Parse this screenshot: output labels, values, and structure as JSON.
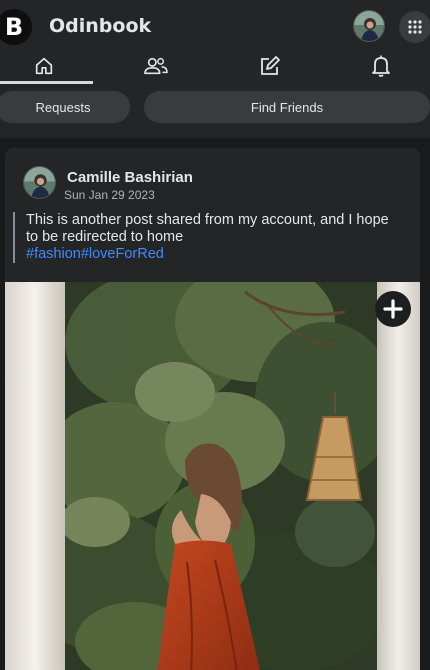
{
  "app": {
    "logo_letter": "B",
    "title": "Odinbook"
  },
  "nav": {
    "items": [
      {
        "name": "home",
        "icon": "home-icon",
        "active": true
      },
      {
        "name": "friends",
        "icon": "users-icon",
        "active": false
      },
      {
        "name": "create-post",
        "icon": "edit-icon",
        "active": false
      },
      {
        "name": "notifications",
        "icon": "bell-icon",
        "active": false
      }
    ]
  },
  "subnav": {
    "requests_label": "Requests",
    "find_friends_label": "Find Friends"
  },
  "post": {
    "author": "Camille Bashirian",
    "date": "Sun Jan 29 2023",
    "text": "This is another post shared from my account, and I hope to be redirected to home",
    "tags": "#fashion#loveForRed",
    "image_icon": "plus-icon"
  },
  "colors": {
    "background": "#191a1b",
    "surface": "#242526",
    "pill": "#3a3b3c",
    "link": "#3d8bfd",
    "dress": "#b03a1c"
  }
}
